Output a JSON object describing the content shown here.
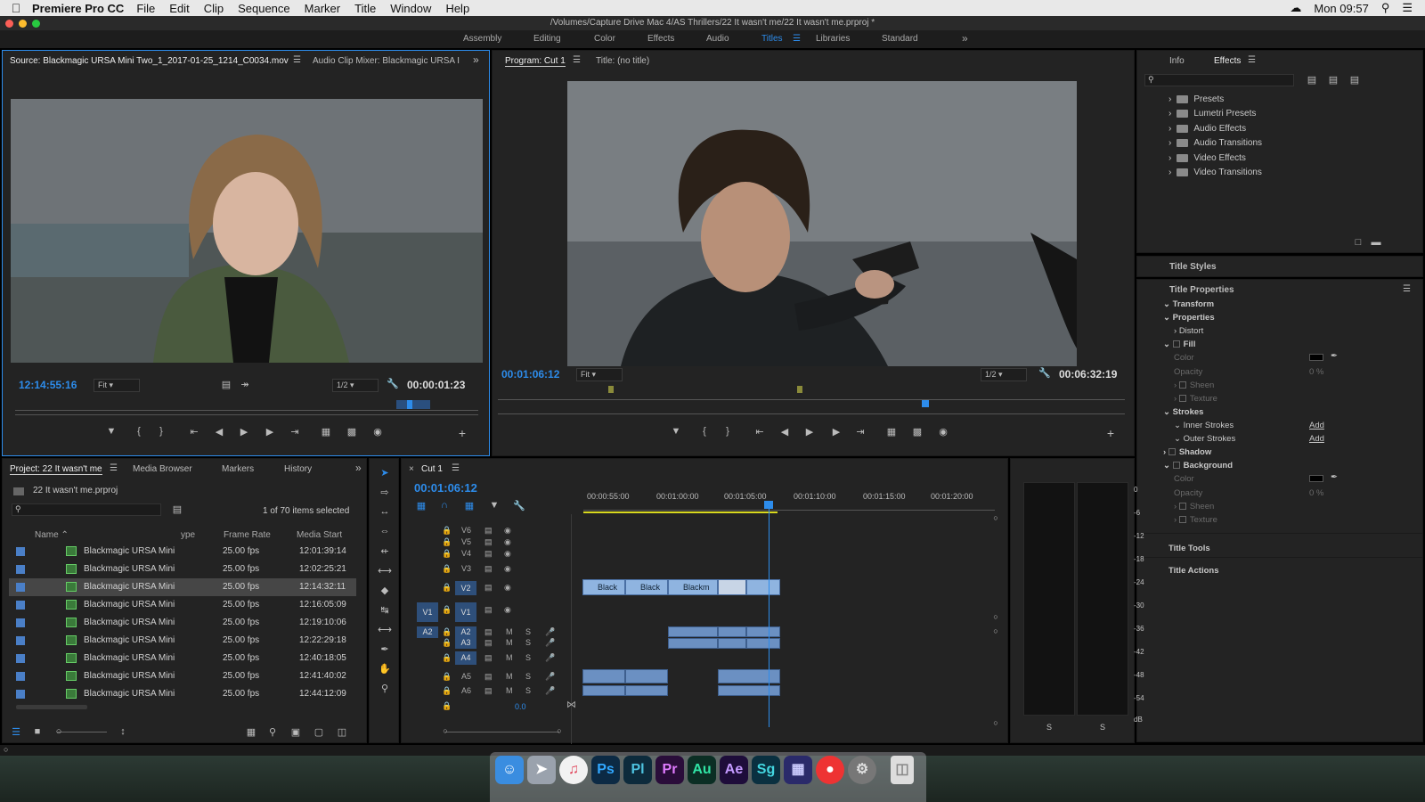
{
  "menubar": {
    "app_name": "Premiere Pro CC",
    "items": [
      "File",
      "Edit",
      "Clip",
      "Sequence",
      "Marker",
      "Title",
      "Window",
      "Help"
    ],
    "clock": "Mon 09:57"
  },
  "titlebar": {
    "path": "/Volumes/Capture Drive Mac 4/AS Thrillers/22 It wasn't me/22 It wasn't me.prproj *"
  },
  "workspaces": {
    "items": [
      "Assembly",
      "Editing",
      "Color",
      "Effects",
      "Audio",
      "Titles",
      "Libraries",
      "Standard"
    ],
    "active": "Titles",
    "more": "»"
  },
  "source": {
    "tab_label": "Source: Blackmagic URSA Mini Two_1_2017-01-25_1214_C0034.mov",
    "tab2_label": "Audio Clip Mixer: Blackmagic URSA I",
    "timecode": "12:14:55:16",
    "fit": "Fit",
    "resolution": "1/2",
    "duration": "00:00:01:23"
  },
  "program": {
    "tab_label": "Program: Cut 1",
    "tab2_label": "Title: (no title)",
    "timecode": "00:01:06:12",
    "fit": "Fit",
    "resolution": "1/2",
    "duration": "00:06:32:19"
  },
  "effects": {
    "tab_info": "Info",
    "tab_effects": "Effects",
    "items": [
      "Presets",
      "Lumetri Presets",
      "Audio Effects",
      "Audio Transitions",
      "Video Effects",
      "Video Transitions"
    ]
  },
  "title_panel": {
    "styles": "Title Styles",
    "properties": "Title Properties",
    "transform": "Transform",
    "props": "Properties",
    "distort": "Distort",
    "fill": "Fill",
    "color": "Color",
    "opacity": "Opacity",
    "opacity_val": "0 %",
    "sheen": "Sheen",
    "texture": "Texture",
    "strokes": "Strokes",
    "inner": "Inner Strokes",
    "outer": "Outer Strokes",
    "add": "Add",
    "shadow": "Shadow",
    "background": "Background",
    "tools": "Title Tools",
    "actions": "Title Actions"
  },
  "project": {
    "tab_label": "Project: 22 It wasn't me",
    "tab_media": "Media Browser",
    "tab_markers": "Markers",
    "tab_history": "History",
    "file": "22 It wasn't me.prproj",
    "count": "1 of 70 items selected",
    "col_name": "Name",
    "col_type": "ype",
    "col_fps": "Frame Rate",
    "col_start": "Media Start",
    "rows": [
      {
        "name": "Blackmagic URSA Mini",
        "fps": "25.00 fps",
        "start": "12:01:39:14"
      },
      {
        "name": "Blackmagic URSA Mini",
        "fps": "25.00 fps",
        "start": "12:02:25:21"
      },
      {
        "name": "Blackmagic URSA Mini",
        "fps": "25.00 fps",
        "start": "12:14:32:11"
      },
      {
        "name": "Blackmagic URSA Mini",
        "fps": "25.00 fps",
        "start": "12:16:05:09"
      },
      {
        "name": "Blackmagic URSA Mini",
        "fps": "25.00 fps",
        "start": "12:19:10:06"
      },
      {
        "name": "Blackmagic URSA Mini",
        "fps": "25.00 fps",
        "start": "12:22:29:18"
      },
      {
        "name": "Blackmagic URSA Mini",
        "fps": "25.00 fps",
        "start": "12:40:18:05"
      },
      {
        "name": "Blackmagic URSA Mini",
        "fps": "25.00 fps",
        "start": "12:41:40:02"
      },
      {
        "name": "Blackmagic URSA Mini",
        "fps": "25.00 fps",
        "start": "12:44:12:09"
      }
    ]
  },
  "timeline": {
    "tab_label": "Cut 1",
    "timecode": "00:01:06:12",
    "ruler": [
      "00:00:55:00",
      "00:01:00:00",
      "00:01:05:00",
      "00:01:10:00",
      "00:01:15:00",
      "00:01:20:00"
    ],
    "video_tracks": [
      "V6",
      "V5",
      "V4",
      "V3",
      "V2",
      "V1"
    ],
    "audio_tracks": [
      "A2",
      "A3",
      "A4",
      "A5",
      "A6"
    ],
    "src_v": "V1",
    "src_a": "A2",
    "clips": [
      "Black",
      "Black",
      "Blackm"
    ],
    "master_vol": "0.0",
    "m": "M",
    "s": "S"
  },
  "meter": {
    "scale": [
      "0",
      "-6",
      "-12",
      "-18",
      "-24",
      "-30",
      "-36",
      "-42",
      "-48",
      "-54",
      "dB"
    ],
    "solo": "S"
  },
  "dock": {
    "apps": [
      "Ps",
      "Pl",
      "Pr",
      "Au",
      "Ae",
      "Sg"
    ]
  }
}
